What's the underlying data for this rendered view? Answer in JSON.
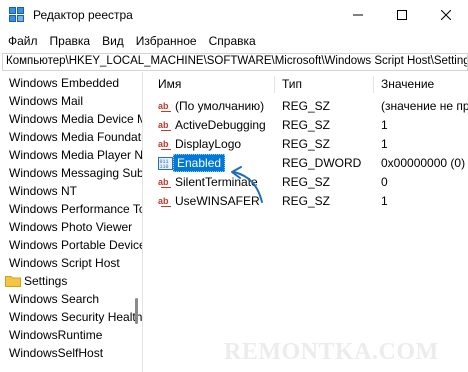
{
  "window": {
    "title": "Редактор реестра",
    "icon": "registry-editor-icon"
  },
  "menu": {
    "items": [
      "Файл",
      "Правка",
      "Вид",
      "Избранное",
      "Справка"
    ]
  },
  "address": {
    "path": "Компьютер\\HKEY_LOCAL_MACHINE\\SOFTWARE\\Microsoft\\Windows Script Host\\Settings"
  },
  "tree": {
    "items": [
      {
        "label": "Windows Embedded",
        "folder": false
      },
      {
        "label": "Windows Mail",
        "folder": false
      },
      {
        "label": "Windows Media Device Manager",
        "folder": false
      },
      {
        "label": "Windows Media Foundation",
        "folder": false
      },
      {
        "label": "Windows Media Player NSS",
        "folder": false
      },
      {
        "label": "Windows Messaging Subsystem",
        "folder": false
      },
      {
        "label": "Windows NT",
        "folder": false
      },
      {
        "label": "Windows Performance Toolkit",
        "folder": false
      },
      {
        "label": "Windows Photo Viewer",
        "folder": false
      },
      {
        "label": "Windows Portable Devices",
        "folder": false
      },
      {
        "label": "Windows Script Host",
        "folder": false
      },
      {
        "label": "Settings",
        "folder": true
      },
      {
        "label": "Windows Search",
        "folder": false
      },
      {
        "label": "Windows Security Health",
        "folder": false
      },
      {
        "label": "WindowsRuntime",
        "folder": false
      },
      {
        "label": "WindowsSelfHost",
        "folder": false
      }
    ]
  },
  "list": {
    "columns": {
      "name": "Имя",
      "type": "Тип",
      "value": "Значение"
    },
    "rows": [
      {
        "name": "(По умолчанию)",
        "type": "REG_SZ",
        "value": "(значение не присвоено)",
        "icon": "string-value-icon"
      },
      {
        "name": "ActiveDebugging",
        "type": "REG_SZ",
        "value": "1",
        "icon": "string-value-icon"
      },
      {
        "name": "DisplayLogo",
        "type": "REG_SZ",
        "value": "1",
        "icon": "string-value-icon"
      },
      {
        "name": "Enabled",
        "type": "REG_DWORD",
        "value": "0x00000000 (0)",
        "icon": "dword-value-icon",
        "selected": true
      },
      {
        "name": "SilentTerminate",
        "type": "REG_SZ",
        "value": "0",
        "icon": "string-value-icon"
      },
      {
        "name": "UseWINSAFER",
        "type": "REG_SZ",
        "value": "1",
        "icon": "string-value-icon"
      }
    ]
  },
  "watermark": "REMONTKA.COM",
  "colors": {
    "selection": "#0078d7",
    "folder": "#f4c542",
    "string_icon": "#c0392b",
    "dword_icon": "#2a6fb0",
    "arrow": "#1f6fb5"
  }
}
